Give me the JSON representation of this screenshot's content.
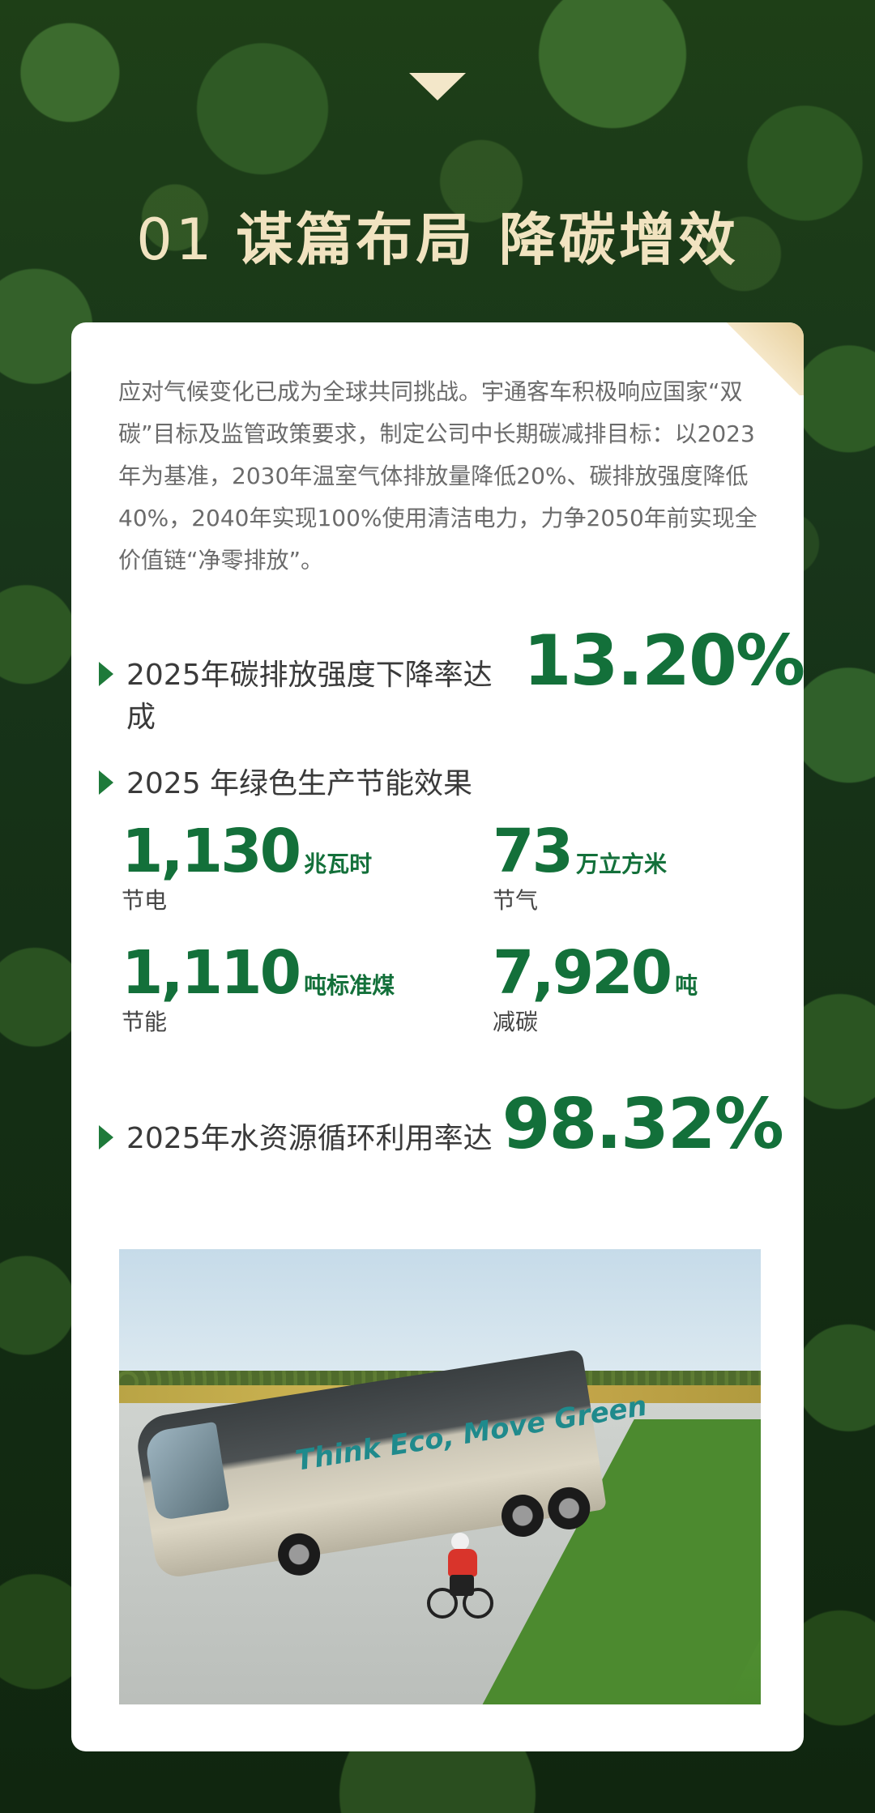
{
  "header": {
    "num": "01",
    "title": "谋篇布局 降碳增效"
  },
  "intro": {
    "text": "应对气候变化已成为全球共同挑战。宇通客车积极响应国家“双碳”目标及监管政策要求，制定公司中长期碳减排目标：以2023年为基准，2030年温室气体排放量降低20%、碳排放强度降低40%，2040年实现100%使用清洁电力，力争2050年前实现全价值链“净零排放”。"
  },
  "stat1": {
    "label": "2025年碳排放强度下降率达成",
    "value": "13.20%"
  },
  "green_production": {
    "title": "2025 年绿色生产节能效果",
    "metrics": [
      {
        "value": "1,130",
        "unit": "兆瓦时",
        "caption": "节电"
      },
      {
        "value": "73",
        "unit": "万立方米",
        "caption": "节气"
      },
      {
        "value": "1,110",
        "unit": "吨标准煤",
        "caption": "节能"
      },
      {
        "value": "7,920",
        "unit": "吨",
        "caption": "减碳"
      }
    ]
  },
  "stat2": {
    "label": "2025年水资源循环利用率达",
    "value": "98.32%"
  },
  "photo": {
    "bus_slogan": "Think Eco, Move Green"
  },
  "colors": {
    "accent_green": "#13703a",
    "title_gold": "#f1e3c0"
  }
}
